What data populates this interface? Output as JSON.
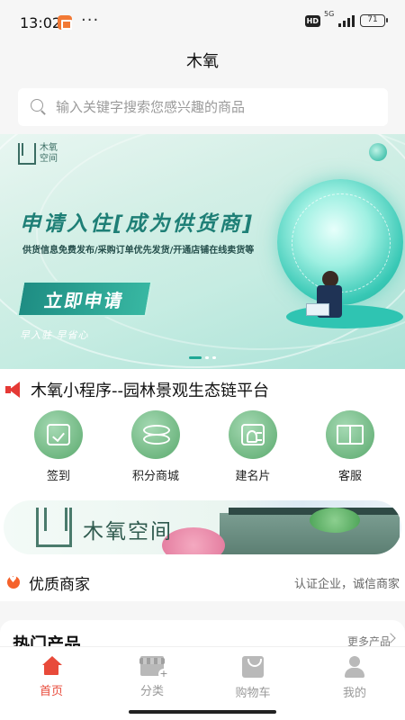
{
  "status": {
    "time": "13:02",
    "dots": "···",
    "hd": "HD",
    "network": "5G",
    "battery": "71"
  },
  "nav": {
    "title": "木氧"
  },
  "search": {
    "placeholder": "输入关键字搜索您感兴趣的商品"
  },
  "banner": {
    "logo_text": "木氧空间",
    "headline": "申请入住[成为供货商]",
    "subline": "供货信息免费发布/采购订单优先发货/开通店铺在线卖货等",
    "cta": "立即申请",
    "slogan": "早入驻 早省心",
    "slides": 3,
    "active_slide": 1
  },
  "notice": {
    "text": "木氧小程序--园林景观生态链平台"
  },
  "grid": [
    {
      "label": "签到",
      "icon": "checkin-icon"
    },
    {
      "label": "积分商城",
      "icon": "coins-icon"
    },
    {
      "label": "建名片",
      "icon": "business-card-icon"
    },
    {
      "label": "客服",
      "icon": "book-icon"
    }
  ],
  "promo": {
    "text": "木氧空间"
  },
  "merchant": {
    "title": "优质商家",
    "subtitle": "认证企业，诚信商家"
  },
  "hot": {
    "title": "热门产品",
    "more": "更多产品"
  },
  "tabbar": [
    {
      "label": "首页",
      "icon": "home-icon",
      "active": true
    },
    {
      "label": "分类",
      "icon": "category-icon",
      "active": false
    },
    {
      "label": "购物车",
      "icon": "cart-icon",
      "active": false
    },
    {
      "label": "我的",
      "icon": "profile-icon",
      "active": false
    }
  ],
  "colors": {
    "accent": "#e84a3a",
    "brand_green": "#1e8d83",
    "icon_green": "#5aa96d"
  }
}
